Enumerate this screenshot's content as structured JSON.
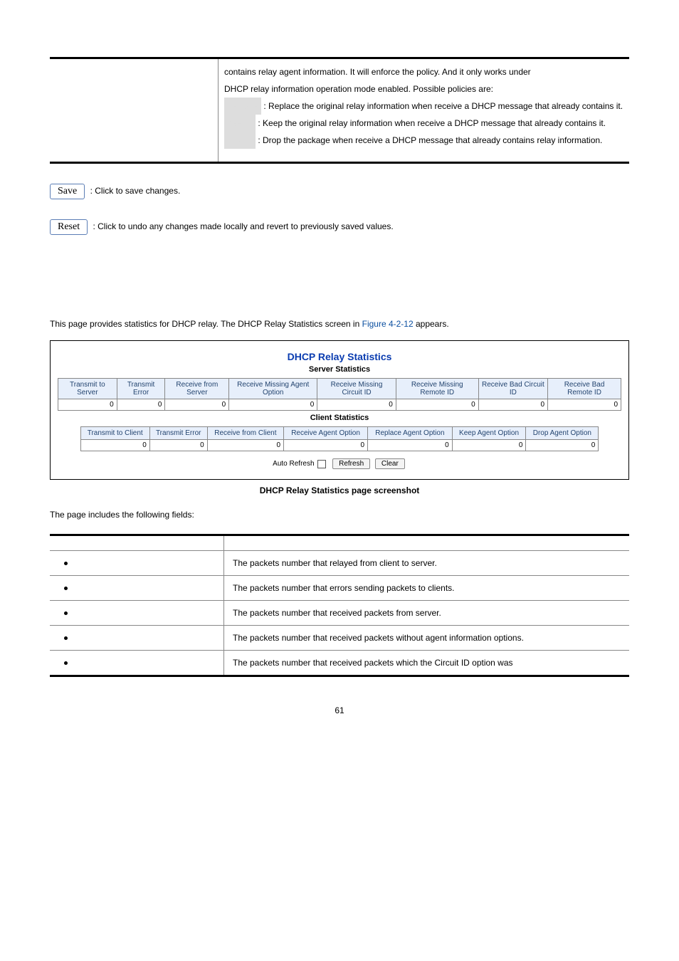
{
  "top_desc": {
    "line1": "contains relay agent information. It will enforce the policy. And it only works under",
    "line2": "DHCP relay information operation mode enabled. Possible policies are:",
    "opt1": ": Replace the original relay information when receive a DHCP message that already contains it.",
    "opt2": ": Keep the original relay information when receive a DHCP message that already contains it.",
    "opt3": ": Drop the package when receive a DHCP message that already contains relay information."
  },
  "buttons": {
    "save_label": "Save",
    "save_desc": ": Click to save changes.",
    "reset_label": "Reset",
    "reset_desc": ": Click to undo any changes made locally and revert to previously saved values."
  },
  "intro": {
    "text_a": "This page provides statistics for DHCP relay. The DHCP Relay Statistics screen in ",
    "figref": "Figure 4-2-12",
    "text_b": " appears."
  },
  "screenshot": {
    "title": "DHCP Relay Statistics",
    "server_sub": "Server Statistics",
    "client_sub": "Client Statistics",
    "server_headers": [
      "Transmit to Server",
      "Transmit Error",
      "Receive from Server",
      "Receive Missing Agent Option",
      "Receive Missing Circuit ID",
      "Receive Missing Remote ID",
      "Receive Bad Circuit ID",
      "Receive Bad Remote ID"
    ],
    "server_row": [
      "0",
      "0",
      "0",
      "0",
      "0",
      "0",
      "0",
      "0"
    ],
    "client_headers": [
      "Transmit to Client",
      "Transmit Error",
      "Receive from Client",
      "Receive Agent Option",
      "Replace Agent Option",
      "Keep Agent Option",
      "Drop Agent Option"
    ],
    "client_row": [
      "0",
      "0",
      "0",
      "0",
      "0",
      "0",
      "0"
    ],
    "auto_refresh": "Auto Refresh",
    "refresh_btn": "Refresh",
    "clear_btn": "Clear"
  },
  "fig_caption_label": "DHCP Relay Statistics page screenshot",
  "fields_intro": "The page includes the following fields:",
  "fields_table": {
    "header_left": "",
    "header_right": "",
    "rows": [
      "The packets number that relayed from client to server.",
      "The packets number that errors sending packets to clients.",
      "The packets number that received packets from server.",
      "The packets number that received packets without agent information options.",
      "The packets number that received packets which the Circuit ID option was"
    ]
  },
  "page_number": "61"
}
